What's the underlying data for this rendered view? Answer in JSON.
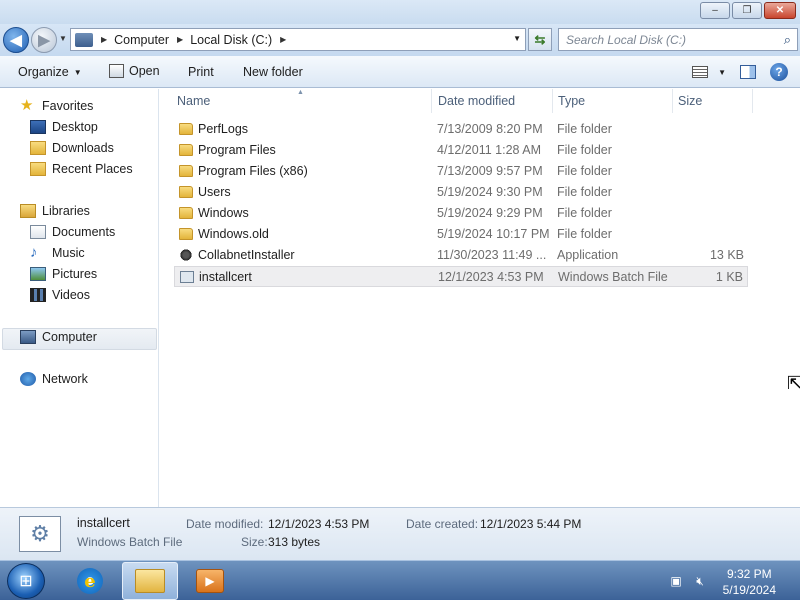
{
  "window": {
    "caption_buttons": {
      "minimize": "–",
      "maximize": "❐",
      "close": "✕"
    }
  },
  "address": {
    "crumbs": [
      "Computer",
      "Local Disk (C:)"
    ],
    "search_placeholder": "Search Local Disk (C:)"
  },
  "toolbar": {
    "organize": "Organize",
    "open": "Open",
    "print": "Print",
    "new_folder": "New folder"
  },
  "nav": {
    "favorites": "Favorites",
    "desktop": "Desktop",
    "downloads": "Downloads",
    "recent_places": "Recent Places",
    "libraries": "Libraries",
    "documents": "Documents",
    "music": "Music",
    "pictures": "Pictures",
    "videos": "Videos",
    "computer": "Computer",
    "network": "Network"
  },
  "columns": {
    "name": "Name",
    "date_modified": "Date modified",
    "type": "Type",
    "size": "Size"
  },
  "files": [
    {
      "name": "PerfLogs",
      "date": "7/13/2009 8:20 PM",
      "type": "File folder",
      "size": "",
      "icon": "folder-icon"
    },
    {
      "name": "Program Files",
      "date": "4/12/2011 1:28 AM",
      "type": "File folder",
      "size": "",
      "icon": "folder-icon"
    },
    {
      "name": "Program Files (x86)",
      "date": "7/13/2009 9:57 PM",
      "type": "File folder",
      "size": "",
      "icon": "folder-icon"
    },
    {
      "name": "Users",
      "date": "5/19/2024 9:30 PM",
      "type": "File folder",
      "size": "",
      "icon": "folder-icon"
    },
    {
      "name": "Windows",
      "date": "5/19/2024 9:29 PM",
      "type": "File folder",
      "size": "",
      "icon": "folder-icon"
    },
    {
      "name": "Windows.old",
      "date": "5/19/2024 10:17 PM",
      "type": "File folder",
      "size": "",
      "icon": "folder-icon"
    },
    {
      "name": "CollabnetInstaller",
      "date": "11/30/2023 11:49 ...",
      "type": "Application",
      "size": "13 KB",
      "icon": "application-icon"
    },
    {
      "name": "installcert",
      "date": "12/1/2023 4:53 PM",
      "type": "Windows Batch File",
      "size": "1 KB",
      "icon": "batch-file-icon"
    }
  ],
  "details": {
    "name": "installcert",
    "type": "Windows Batch File",
    "date_modified_label": "Date modified:",
    "date_modified": "12/1/2023 4:53 PM",
    "size_label": "Size:",
    "size": "313 bytes",
    "date_created_label": "Date created:",
    "date_created": "12/1/2023 5:44 PM"
  },
  "taskbar": {
    "time": "9:32 PM",
    "date": "5/19/2024"
  }
}
